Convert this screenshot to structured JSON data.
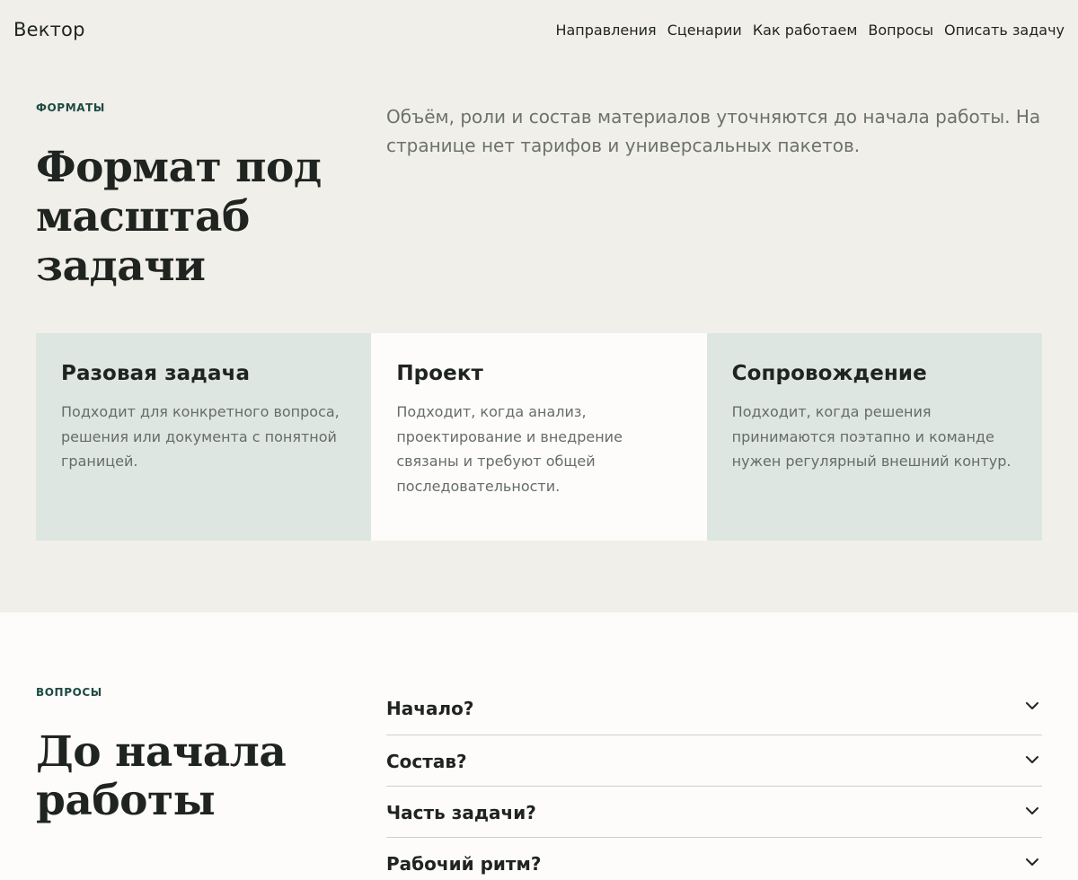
{
  "header": {
    "brand": "Вектор",
    "nav": [
      {
        "label": "Направления"
      },
      {
        "label": "Сценарии"
      },
      {
        "label": "Как работаем"
      },
      {
        "label": "Вопросы"
      },
      {
        "label": "Описать задачу"
      }
    ]
  },
  "formats": {
    "eyebrow": "ФОРМАТЫ",
    "title": "Формат под масштаб задачи",
    "lead": "Объём, роли и состав материалов уточняются до начала работы. На странице нет тарифов и универсальных пакетов.",
    "cards": [
      {
        "title": "Разовая задача",
        "text": "Подходит для конкретного вопроса, решения или документа с понятной границей."
      },
      {
        "title": "Проект",
        "text": "Подходит, когда анализ, проектирование и внедрение связаны и требуют общей последовательности."
      },
      {
        "title": "Сопровождение",
        "text": "Подходит, когда решения принимаются поэтапно и команде нужен регулярный внешний контур."
      }
    ]
  },
  "faq": {
    "eyebrow": "ВОПРОСЫ",
    "title": "До начала работы",
    "items": [
      {
        "question": "Начало?",
        "icon": "chevron-down-icon"
      },
      {
        "question": "Состав?",
        "icon": "chevron-down-icon"
      },
      {
        "question": "Часть задачи?",
        "icon": "chevron-down-icon"
      },
      {
        "question": "Рабочий ритм?",
        "icon": "chevron-down-icon"
      }
    ]
  },
  "colors": {
    "page_bg": "#f1efe9",
    "accent": "#1d4a44",
    "card_tint": "#dde6e0",
    "surface": "#fdfcfa"
  }
}
